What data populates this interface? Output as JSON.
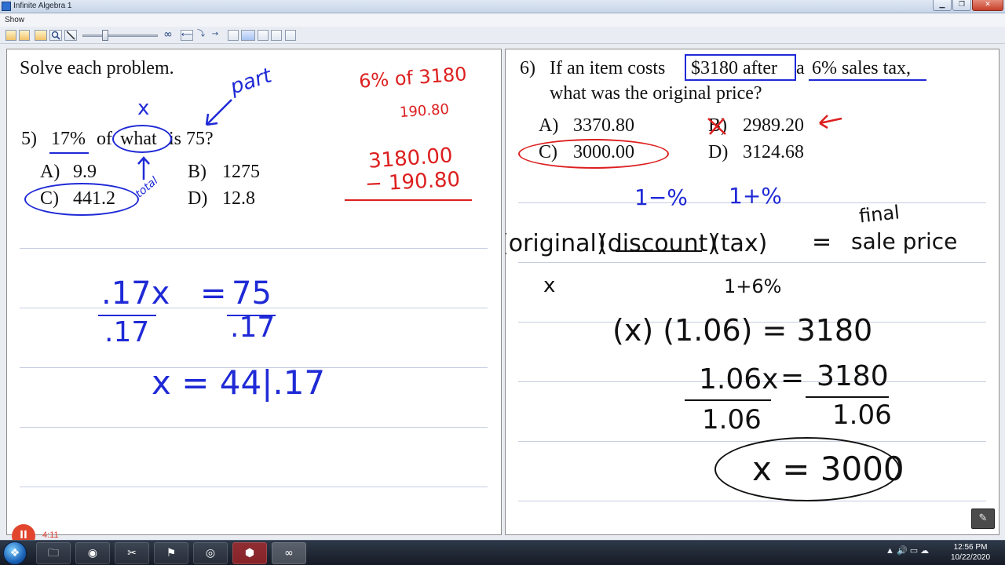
{
  "window": {
    "title": "Infinite Algebra 1",
    "controls": {
      "minimize": "▁",
      "restore": "❐",
      "close": "✕"
    }
  },
  "menu": {
    "show": "Show"
  },
  "toolbar": {
    "infinity_label": "∞",
    "undo_label": "⟵",
    "step_label": "⤵",
    "forward_label": "→"
  },
  "left_pane": {
    "instruction": "Solve each problem.",
    "problem_5": {
      "number": "5)",
      "stem_parts": [
        "17%",
        "of",
        "what",
        "is 75?"
      ],
      "choices": [
        {
          "letter": "A)",
          "value": "9.9"
        },
        {
          "letter": "B)",
          "value": "1275"
        },
        {
          "letter": "C)",
          "value": "441.2"
        },
        {
          "letter": "D)",
          "value": "12.8"
        }
      ]
    },
    "annotations": {
      "x_label": "x",
      "part_label": "part",
      "total_label": "total",
      "red_work_1": "6% of 3180",
      "red_work_2": "190.80",
      "red_work_3": "3180.00",
      "red_work_4": "− 190.80",
      "eq_left": ".17x",
      "eq_equals": "=",
      "eq_right": "75",
      "den_left": ".17",
      "den_right": ".17",
      "result": "x =  44|.17"
    }
  },
  "right_pane": {
    "problem_6": {
      "number": "6)",
      "line1_parts": [
        "If an item costs",
        "$3180 after",
        "a",
        "6% sales tax,"
      ],
      "line2": "what was the original price?",
      "choices": [
        {
          "letter": "A)",
          "value": "3370.80"
        },
        {
          "letter": "B)",
          "value": "2989.20"
        },
        {
          "letter": "C)",
          "value": "3000.00"
        },
        {
          "letter": "D)",
          "value": "3124.68"
        }
      ]
    },
    "annotations": {
      "minus_pct": "1−%",
      "plus_pct": "1+%",
      "final_label": "final",
      "formula_original": "(original)",
      "formula_discount": "(discount)",
      "formula_tax": "(tax)",
      "formula_equals": "=",
      "formula_sale": "sale price",
      "under_x": "x",
      "under_tax": "1+6%",
      "eq1": "(x) (1.06)  =  3180",
      "eq2_left": "1.06x",
      "eq2_equals": "=",
      "eq2_right": "3180",
      "eq2_den_left": "1.06",
      "eq2_den_right": "1.06",
      "answer": "x = 3000"
    }
  },
  "recording": {
    "badge": "II",
    "time": "4:11"
  },
  "taskbar": {
    "start": "❖",
    "apps": [
      "🗀",
      "◉",
      "✂",
      "⚑",
      "◎",
      "⬢",
      "∞"
    ],
    "tray_icons": "▲  🔊  ▭  ☁",
    "clock_time": "12:56 PM",
    "clock_date": "10/22/2020"
  },
  "colors": {
    "ink_blue": "#1f2ad6",
    "ink_red": "#dd1f1f",
    "ink_black": "#111111",
    "rule_line": "#c7cde0"
  }
}
